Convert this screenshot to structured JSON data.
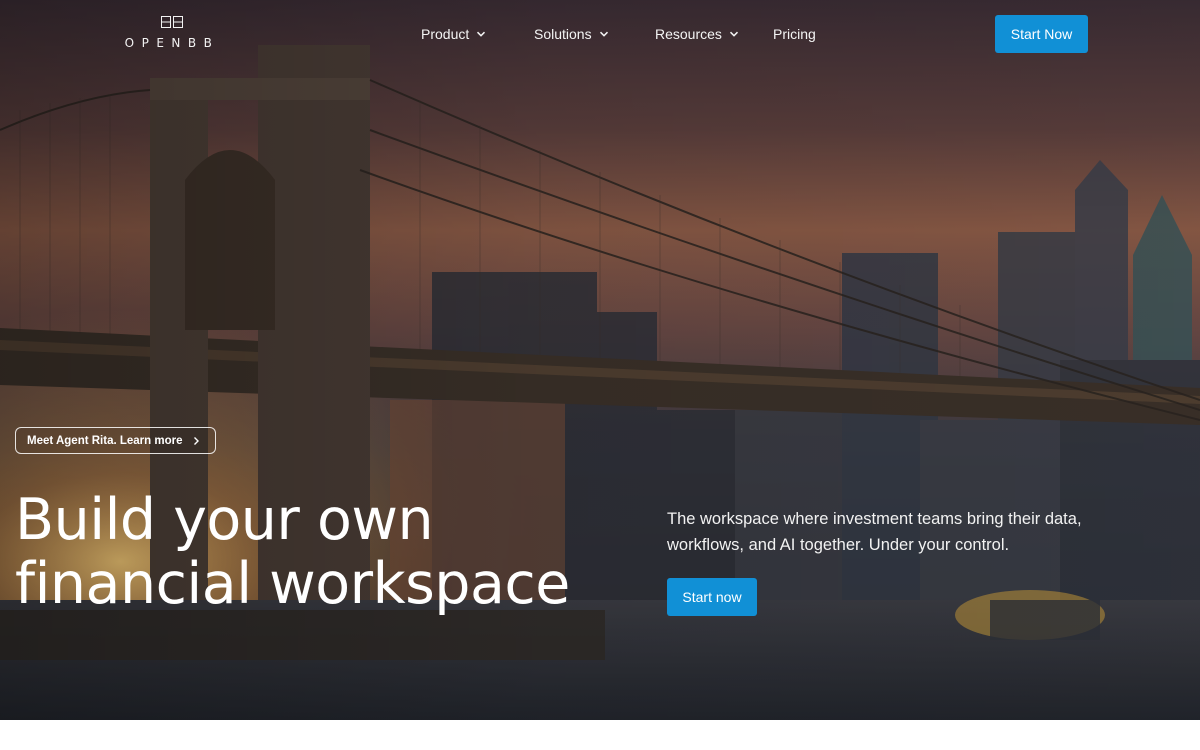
{
  "brand": {
    "name": "OPENBB",
    "icon": "openbb-logo-icon"
  },
  "nav": {
    "items": [
      {
        "label": "Product",
        "has_dropdown": true
      },
      {
        "label": "Solutions",
        "has_dropdown": true
      },
      {
        "label": "Resources",
        "has_dropdown": true
      },
      {
        "label": "Pricing",
        "has_dropdown": false
      }
    ],
    "cta_label": "Start Now"
  },
  "hero": {
    "announcement": "Meet Agent Rita. Learn more",
    "headline_line1": "Build your own",
    "headline_line2": "financial workspace",
    "subtitle": "The workspace where investment teams bring their data, workflows, and AI together. Under your control.",
    "cta_label": "Start now",
    "background": "brooklyn-bridge-sunset-photo"
  },
  "colors": {
    "accent": "#1190d6",
    "text": "#ffffff"
  }
}
